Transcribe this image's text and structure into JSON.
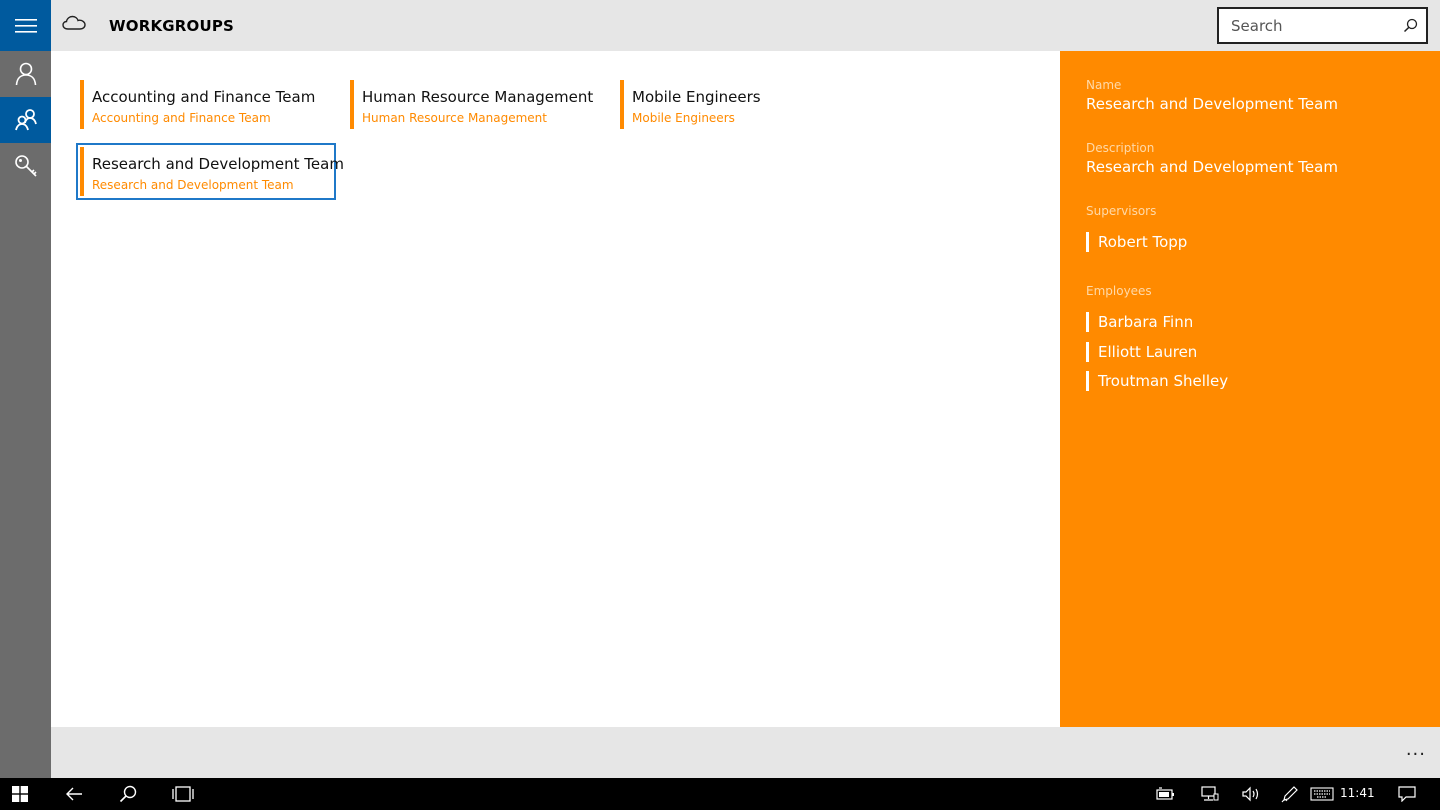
{
  "header": {
    "title": "WORKGROUPS",
    "search_placeholder": "Search"
  },
  "groups": [
    {
      "name": "Accounting and Finance Team",
      "description": "Accounting and Finance Team"
    },
    {
      "name": "Human Resource Management",
      "description": "Human Resource Management"
    },
    {
      "name": "Mobile Engineers",
      "description": "Mobile Engineers"
    },
    {
      "name": "Research and Development Team",
      "description": "Research and Development Team",
      "selected": true
    }
  ],
  "details": {
    "name_label": "Name",
    "name_value": "Research and Development Team",
    "description_label": "Description",
    "description_value": "Research and Development Team",
    "supervisors_label": "Supervisors",
    "supervisors": [
      "Robert Topp"
    ],
    "employees_label": "Employees",
    "employees": [
      "Barbara Finn",
      "Elliott Lauren",
      "Troutman Shelley"
    ]
  },
  "command_bar": {
    "more_label": "..."
  },
  "taskbar": {
    "clock": "11:41"
  },
  "colors": {
    "accent_orange": "#ff8a00",
    "rail_blue": "#005a9e",
    "rail_gray": "#6c6c6c",
    "selection_blue": "#1f78c8"
  },
  "icons": {
    "rail": [
      "hamburger-icon",
      "person-icon",
      "group-icon",
      "key-icon"
    ],
    "taskbar": [
      "windows-icon",
      "back-icon",
      "search-icon",
      "task-view-icon",
      "battery-icon",
      "network-icon",
      "volume-icon",
      "pen-icon",
      "keyboard-icon",
      "notification-icon"
    ]
  }
}
